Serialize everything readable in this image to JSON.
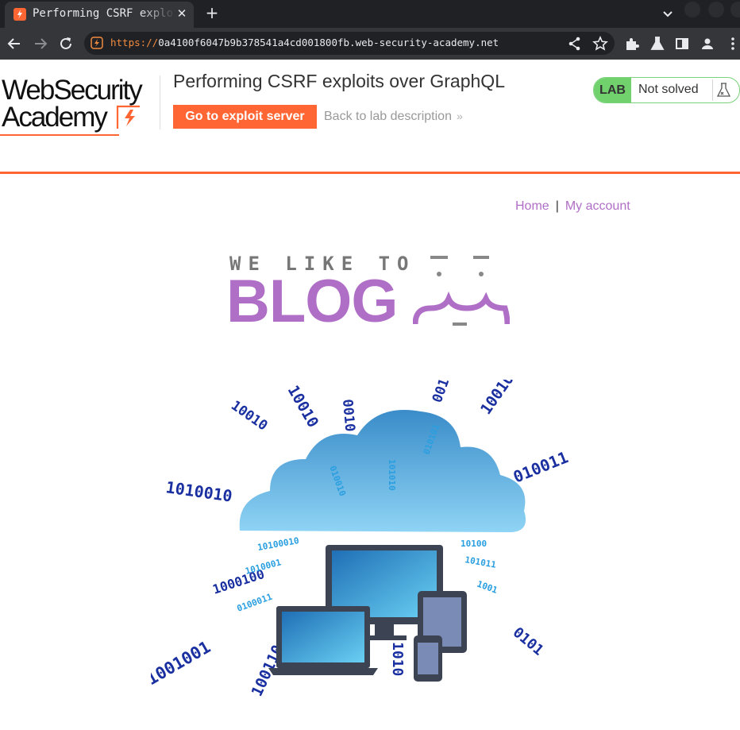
{
  "browser": {
    "tab_title": "Performing CSRF exploits over GraphQL",
    "tab_close_glyph": "✕",
    "new_tab_glyph": "+",
    "url_scheme": "https://",
    "url_rest": "0a4100f6047b9b378541a4cd001800fb.web-security-academy.net",
    "icons": [
      "back-icon",
      "forward-icon",
      "reload-icon",
      "share-icon",
      "star-icon",
      "extensions-icon",
      "labs-icon",
      "sidepanel-icon",
      "profile-icon",
      "menu-icon"
    ],
    "colors": {
      "frame": "#202124",
      "toolbar": "#35363a",
      "accent": "#f28b40"
    }
  },
  "header": {
    "logo_line1": "WebSecurity",
    "logo_line2": "Academy",
    "lab_title": "Performing CSRF exploits over GraphQL",
    "exploit_button": "Go to exploit server",
    "back_link": "Back to lab description",
    "back_chevrons": "»",
    "lab_badge_label": "LAB",
    "lab_status": "Not solved",
    "colors": {
      "brand_orange": "#ff6633",
      "lab_green": "#70d16d"
    }
  },
  "nav": {
    "home": "Home",
    "separator": "|",
    "my_account": "My account",
    "link_color": "#b06fc6"
  },
  "banner": {
    "small_text": "WE LIKE TO",
    "big_text": "BLOG"
  }
}
